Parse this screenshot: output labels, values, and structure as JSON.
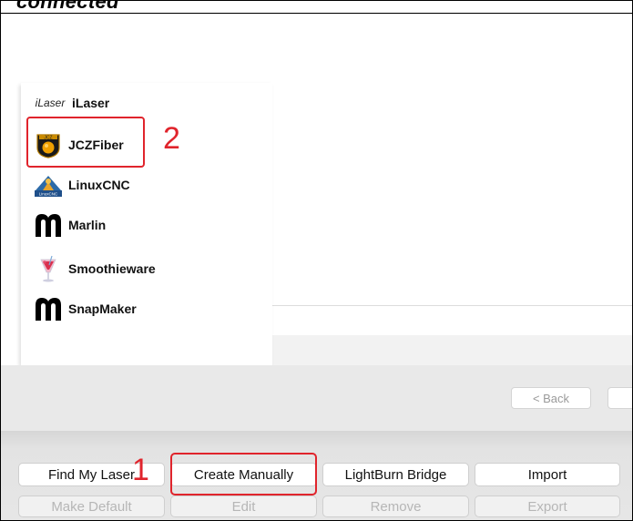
{
  "header": {
    "partial_text": "connected"
  },
  "device_list": {
    "items": [
      {
        "logo_text": "iLaser",
        "label": "iLaser",
        "icon": "ilaser-logo-icon"
      },
      {
        "label": "JCZFiber",
        "icon": "jcz-logo-icon"
      },
      {
        "label": "LinuxCNC",
        "icon": "linuxcnc-logo-icon"
      },
      {
        "label": "Marlin",
        "icon": "marlin-logo-icon"
      },
      {
        "label": "Smoothieware",
        "icon": "smoothieware-logo-icon"
      },
      {
        "label": "SnapMaker",
        "icon": "snapmaker-logo-icon"
      }
    ]
  },
  "annotations": {
    "step1": "1",
    "step2": "2",
    "color": "#e0242c"
  },
  "nav": {
    "back_label": "< Back"
  },
  "toolbar": {
    "find_my_laser": "Find My Laser",
    "create_manually": "Create Manually",
    "lightburn_bridge": "LightBurn Bridge",
    "import": "Import",
    "make_default": "Make Default",
    "edit": "Edit",
    "remove": "Remove",
    "export": "Export"
  }
}
